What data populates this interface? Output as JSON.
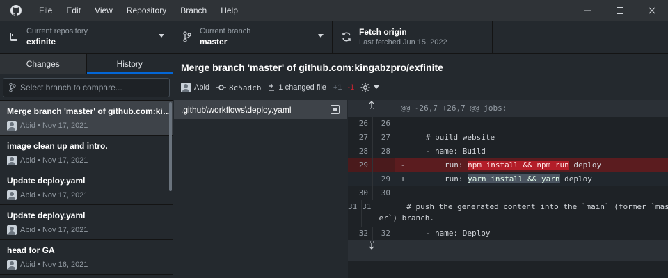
{
  "titlebar": {
    "menu": [
      "File",
      "Edit",
      "View",
      "Repository",
      "Branch",
      "Help"
    ]
  },
  "toolbar": {
    "repo_label": "Current repository",
    "repo_value": "exfinite",
    "branch_label": "Current branch",
    "branch_value": "master",
    "fetch_label": "Fetch origin",
    "fetch_sub": "Last fetched Jun 15, 2022"
  },
  "sidebar": {
    "tab_changes": "Changes",
    "tab_history": "History",
    "search_placeholder": "Select branch to compare...",
    "commits": [
      {
        "title": "Merge branch 'master' of github.com:kingabzpro/exfinite",
        "meta": "Abid • Nov 17, 2021"
      },
      {
        "title": "image clean up and intro.",
        "meta": "Abid • Nov 17, 2021"
      },
      {
        "title": "Update deploy.yaml",
        "meta": "Abid • Nov 17, 2021"
      },
      {
        "title": "Update deploy.yaml",
        "meta": "Abid • Nov 17, 2021"
      },
      {
        "title": "head for GA",
        "meta": "Abid • Nov 16, 2021"
      }
    ]
  },
  "main": {
    "title": "Merge branch 'master' of github.com:kingabzpro/exfinite",
    "author": "Abid",
    "sha": "8c5adcb",
    "changed": "1 changed file",
    "additions": "+1",
    "deletions": "-1",
    "file": ".github\\workflows\\deploy.yaml"
  },
  "diff": {
    "hunk": "@@ -26,7 +26,7 @@ jobs:",
    "lines": [
      {
        "old": "26",
        "new": "26",
        "sym": "",
        "text": ""
      },
      {
        "old": "27",
        "new": "27",
        "sym": "",
        "text": "      # build website"
      },
      {
        "old": "28",
        "new": "28",
        "sym": "",
        "text": "      - name: Build"
      },
      {
        "old": "29",
        "new": "",
        "sym": "-",
        "pre": "        run: ",
        "hl": "npm install && npm run",
        "post": " deploy"
      },
      {
        "old": "",
        "new": "29",
        "sym": "+",
        "pre": "        run: ",
        "hl": "yarn install && yarn",
        "post": " deploy"
      },
      {
        "old": "30",
        "new": "30",
        "sym": "",
        "text": ""
      },
      {
        "old": "31",
        "new": "31",
        "sym": "",
        "text": "      # push the generated content into the `main` (former `mast",
        "wrap": "er`) branch."
      },
      {
        "old": "32",
        "new": "32",
        "sym": "",
        "text": "      - name: Deploy"
      }
    ]
  },
  "icons": {
    "logo": "github-icon",
    "repo": "repo-icon",
    "branch": "branch-icon",
    "fetch": "sync-icon"
  }
}
